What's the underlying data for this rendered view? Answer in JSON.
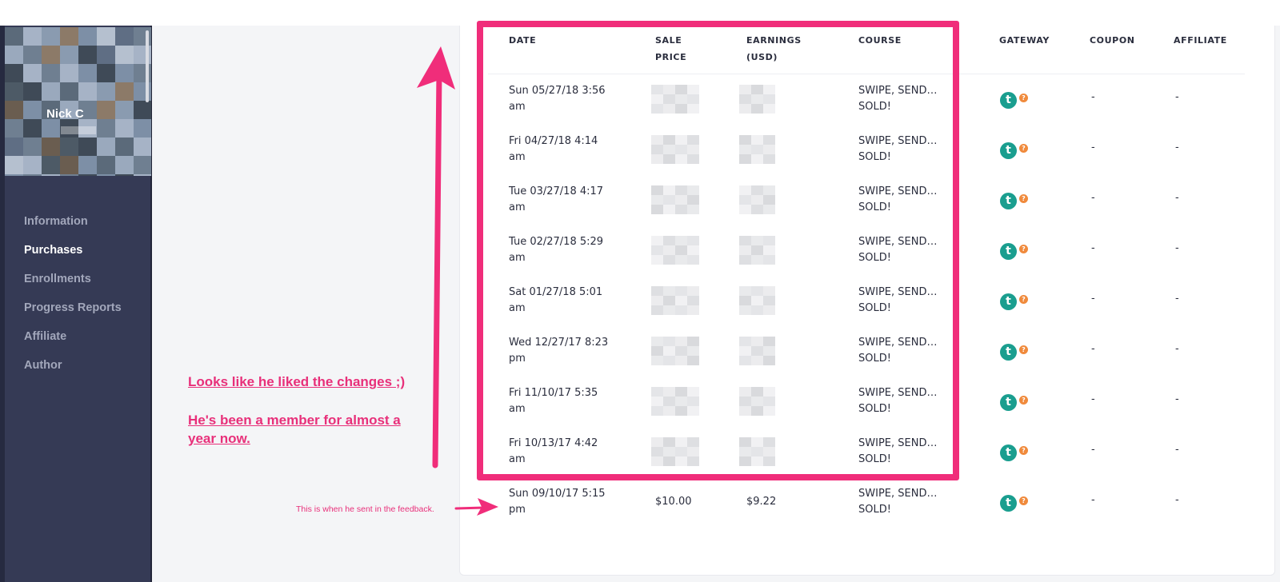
{
  "sidebar": {
    "user_name": "Nick C",
    "items": [
      {
        "label": "Information",
        "active": false
      },
      {
        "label": "Purchases",
        "active": true
      },
      {
        "label": "Enrollments",
        "active": false
      },
      {
        "label": "Progress Reports",
        "active": false
      },
      {
        "label": "Affiliate",
        "active": false
      },
      {
        "label": "Author",
        "active": false
      }
    ]
  },
  "table": {
    "headers": {
      "date": "DATE",
      "sale_price_1": "SALE",
      "sale_price_2": "PRICE",
      "earnings_1": "EARNINGS",
      "earnings_2": "(USD)",
      "course": "COURSE",
      "gateway": "GATEWAY",
      "coupon": "COUPON",
      "affiliate": "AFFILIATE"
    },
    "rows": [
      {
        "date_1": "Sun 05/27/18 3:56",
        "date_2": "am",
        "sale_price": "",
        "earnings": "",
        "course_1": "SWIPE, SEND…",
        "course_2": "SOLD!",
        "gateway_icon": "t",
        "coupon": "-",
        "affiliate": "-"
      },
      {
        "date_1": "Fri 04/27/18 4:14",
        "date_2": "am",
        "sale_price": "",
        "earnings": "",
        "course_1": "SWIPE, SEND…",
        "course_2": "SOLD!",
        "gateway_icon": "t",
        "coupon": "-",
        "affiliate": "-"
      },
      {
        "date_1": "Tue 03/27/18 4:17",
        "date_2": "am",
        "sale_price": "",
        "earnings": "",
        "course_1": "SWIPE, SEND…",
        "course_2": "SOLD!",
        "gateway_icon": "t",
        "coupon": "-",
        "affiliate": "-"
      },
      {
        "date_1": "Tue 02/27/18 5:29",
        "date_2": "am",
        "sale_price": "",
        "earnings": "",
        "course_1": "SWIPE, SEND…",
        "course_2": "SOLD!",
        "gateway_icon": "t",
        "coupon": "-",
        "affiliate": "-"
      },
      {
        "date_1": "Sat 01/27/18 5:01",
        "date_2": "am",
        "sale_price": "",
        "earnings": "",
        "course_1": "SWIPE, SEND…",
        "course_2": "SOLD!",
        "gateway_icon": "t",
        "coupon": "-",
        "affiliate": "-"
      },
      {
        "date_1": "Wed 12/27/17 8:23",
        "date_2": "pm",
        "sale_price": "",
        "earnings": "",
        "course_1": "SWIPE, SEND…",
        "course_2": "SOLD!",
        "gateway_icon": "t",
        "coupon": "-",
        "affiliate": "-"
      },
      {
        "date_1": "Fri 11/10/17 5:35",
        "date_2": "am",
        "sale_price": "",
        "earnings": "",
        "course_1": "SWIPE, SEND…",
        "course_2": "SOLD!",
        "gateway_icon": "t",
        "coupon": "-",
        "affiliate": "-"
      },
      {
        "date_1": "Fri 10/13/17 4:42",
        "date_2": "am",
        "sale_price": "",
        "earnings": "",
        "course_1": "SWIPE, SEND…",
        "course_2": "SOLD!",
        "gateway_icon": "t",
        "coupon": "-",
        "affiliate": "-"
      },
      {
        "date_1": "Sun 09/10/17 5:15",
        "date_2": "pm",
        "sale_price": "$10.00",
        "earnings": "$9.22",
        "course_1": "SWIPE, SEND…",
        "course_2": "SOLD!",
        "gateway_icon": "t",
        "coupon": "-",
        "affiliate": "-"
      }
    ]
  },
  "annotations": {
    "note_line_1": "Looks like he liked the changes ;)",
    "note_line_2": "He's been a member for almost a",
    "note_line_3": "year now.",
    "note_small": "This is when he sent in the feedback.",
    "color": "#e8307a",
    "highlight_color": "#f02d7a"
  },
  "colors": {
    "sidebar_bg": "#353a55",
    "gateway_teal": "#1a9e8f",
    "gateway_help_orange": "#f08a3c"
  }
}
